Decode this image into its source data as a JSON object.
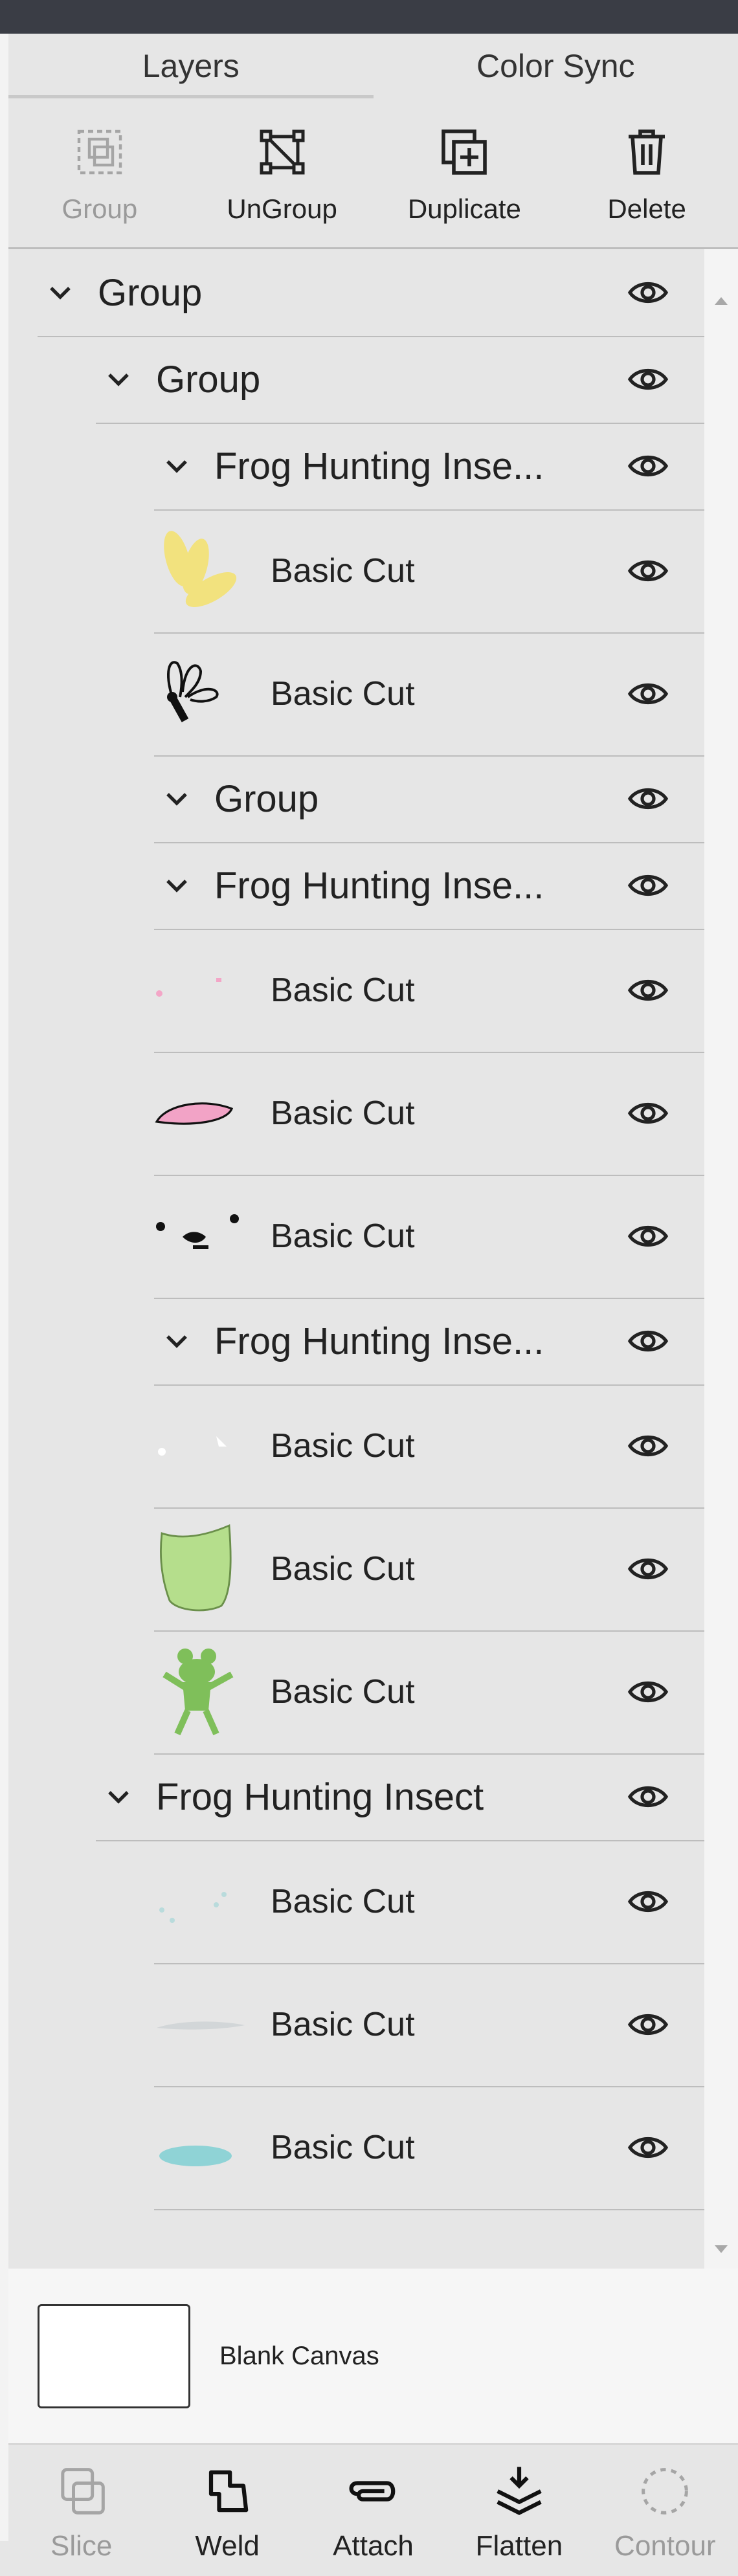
{
  "tabs": [
    {
      "label": "Layers",
      "active": true
    },
    {
      "label": "Color Sync",
      "active": false
    }
  ],
  "toolbar": {
    "group": "Group",
    "ungroup": "UnGroup",
    "duplicate": "Duplicate",
    "delete": "Delete"
  },
  "layers": [
    {
      "kind": "group",
      "level": 0,
      "title": "Group"
    },
    {
      "kind": "group",
      "level": 1,
      "title": "Group"
    },
    {
      "kind": "group",
      "level": 2,
      "title": "Frog Hunting Inse..."
    },
    {
      "kind": "cut",
      "level": 2,
      "title": "Basic Cut",
      "thumb": "yellow-petals",
      "color": "#f2e27e"
    },
    {
      "kind": "cut",
      "level": 2,
      "title": "Basic Cut",
      "thumb": "black-petals-outline",
      "color": "#111111"
    },
    {
      "kind": "group",
      "level": 2,
      "title": "Group"
    },
    {
      "kind": "group",
      "level": 2,
      "title": "Frog Hunting Inse..."
    },
    {
      "kind": "cut",
      "level": 2,
      "title": "Basic Cut",
      "thumb": "pink-dots",
      "color": "#f3a6c7"
    },
    {
      "kind": "cut",
      "level": 2,
      "title": "Basic Cut",
      "thumb": "pink-blob",
      "color": "#f2a3c6"
    },
    {
      "kind": "cut",
      "level": 2,
      "title": "Basic Cut",
      "thumb": "black-face-marks",
      "color": "#111111"
    },
    {
      "kind": "group",
      "level": 2,
      "title": "Frog Hunting Inse..."
    },
    {
      "kind": "cut",
      "level": 2,
      "title": "Basic Cut",
      "thumb": "white-spots",
      "color": "#ffffff"
    },
    {
      "kind": "cut",
      "level": 2,
      "title": "Basic Cut",
      "thumb": "green-body",
      "color": "#b5de8c"
    },
    {
      "kind": "cut",
      "level": 2,
      "title": "Basic Cut",
      "thumb": "green-frog",
      "color": "#7fbf5a"
    },
    {
      "kind": "group",
      "level": 1,
      "title": "Frog Hunting Insect"
    },
    {
      "kind": "cut",
      "level": 2,
      "title": "Basic Cut",
      "thumb": "teal-dots",
      "color": "#b9dbdc"
    },
    {
      "kind": "cut",
      "level": 2,
      "title": "Basic Cut",
      "thumb": "grey-streak",
      "color": "#d2d6d8"
    },
    {
      "kind": "cut",
      "level": 2,
      "title": "Basic Cut",
      "thumb": "teal-blob",
      "color": "#8fd3d6"
    }
  ],
  "canvas": {
    "label": "Blank Canvas"
  },
  "bottom_toolbar": {
    "slice": "Slice",
    "weld": "Weld",
    "attach": "Attach",
    "flatten": "Flatten",
    "contour": "Contour"
  }
}
